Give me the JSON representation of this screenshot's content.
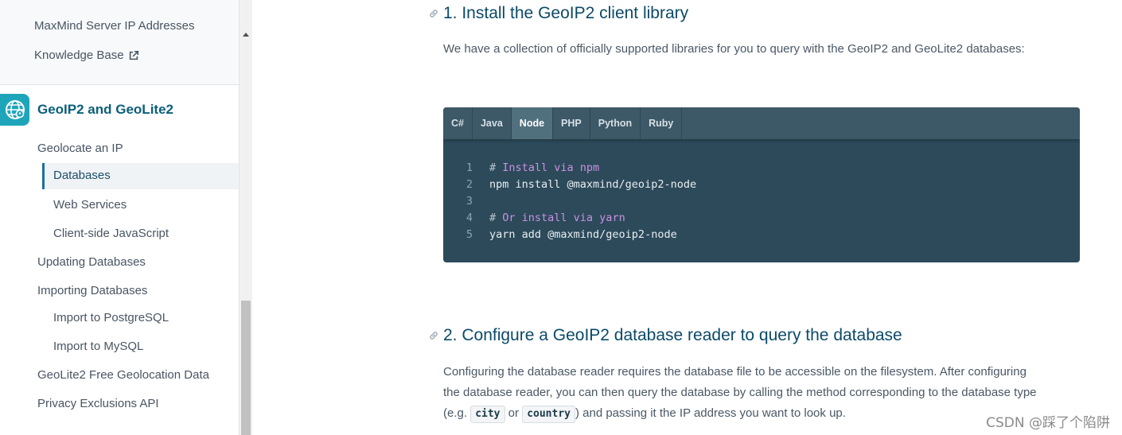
{
  "sidebar": {
    "cut_item": "MaxMind Server IP Addresses",
    "knowledge_base": "Knowledge Base",
    "product_title": "GeoIP2 and GeoLite2",
    "nav": {
      "geolocate": "Geolocate an IP",
      "databases": "Databases",
      "web_services": "Web Services",
      "client_js": "Client-side JavaScript",
      "updating": "Updating Databases",
      "importing": "Importing Databases",
      "postgres": "Import to PostgreSQL",
      "mysql": "Import to MySQL",
      "geolite_free": "GeoLite2 Free Geolocation Data",
      "privacy": "Privacy Exclusions API"
    }
  },
  "main": {
    "section1": {
      "heading": "1. Install the GeoIP2 client library",
      "paragraph": "We have a collection of officially supported libraries for you to query with the GeoIP2 and GeoLite2 databases:"
    },
    "code": {
      "tabs": [
        "C#",
        "Java",
        "Node",
        "PHP",
        "Python",
        "Ruby"
      ],
      "active_tab": "Node",
      "lines": [
        {
          "num": "1",
          "hash": "#",
          "comment": " Install via npm",
          "text": ""
        },
        {
          "num": "2",
          "hash": "",
          "comment": "",
          "text": "npm install @maxmind/geoip2-node"
        },
        {
          "num": "3",
          "hash": "",
          "comment": "",
          "text": ""
        },
        {
          "num": "4",
          "hash": "#",
          "comment": " Or install via yarn",
          "text": ""
        },
        {
          "num": "5",
          "hash": "",
          "comment": "",
          "text": "yarn add @maxmind/geoip2-node"
        }
      ]
    },
    "section2": {
      "heading": "2. Configure a GeoIP2 database reader to query the database",
      "para_line1": "Configuring the database reader requires the database file to be accessible on the filesystem. After configuring",
      "para_line2": "the database reader, you can then query the database by calling the method corresponding to the database type",
      "para_line3_pre": "(e.g. ",
      "code_city": "city",
      "para_or": " or ",
      "code_country": "country",
      "para_line3_post": ") and passing it the IP address you want to look up."
    }
  },
  "watermark": "CSDN @踩了个陷阱",
  "colors": {
    "heading": "#0c4a68",
    "code_bg": "#2c4a5a",
    "tab_active": "#51707e",
    "comment": "#c991e1",
    "accent": "#1c6fa0"
  }
}
